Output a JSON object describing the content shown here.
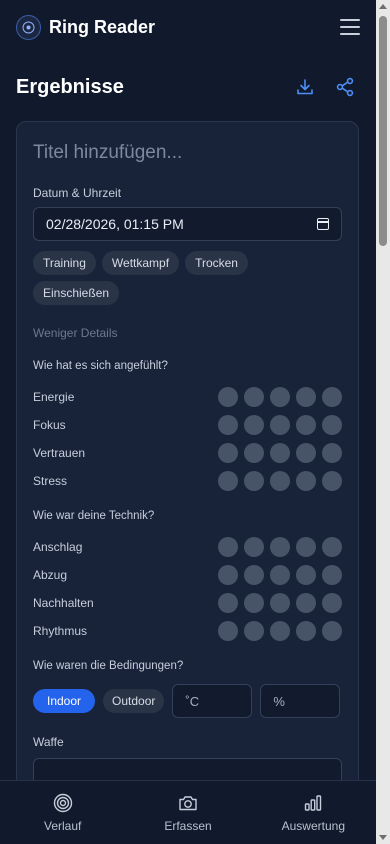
{
  "app": {
    "title": "Ring Reader"
  },
  "header": {
    "title": "Ergebnisse"
  },
  "form": {
    "title_placeholder": "Titel hinzufügen...",
    "datetime_label": "Datum & Uhrzeit",
    "datetime_value": "02/28/2026, 01:15 PM",
    "tags": [
      "Training",
      "Wettkampf",
      "Trocken",
      "Einschießen"
    ],
    "toggle_details": "Weniger Details",
    "feeling": {
      "heading": "Wie hat es sich angefühlt?",
      "items": [
        "Energie",
        "Fokus",
        "Vertrauen",
        "Stress"
      ]
    },
    "technique": {
      "heading": "Wie war deine Technik?",
      "items": [
        "Anschlag",
        "Abzug",
        "Nachhalten",
        "Rhythmus"
      ]
    },
    "conditions": {
      "heading": "Wie waren die Bedingungen?",
      "indoor": "Indoor",
      "outdoor": "Outdoor",
      "selected": "Indoor",
      "temp_placeholder": "˚C",
      "humidity_placeholder": "%"
    },
    "weapon_label": "Waffe"
  },
  "nav": {
    "history": "Verlauf",
    "capture": "Erfassen",
    "analysis": "Auswertung"
  },
  "colors": {
    "background": "#111a2c",
    "card": "#18233a",
    "accent": "#2463eb",
    "icon_accent": "#4d8ef7",
    "dot": "#475366"
  }
}
